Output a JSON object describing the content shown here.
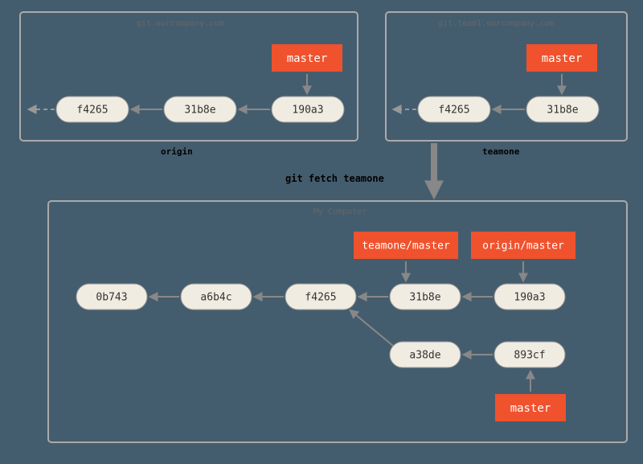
{
  "origin": {
    "host": "git.ourcompany.com",
    "label": "origin",
    "branch": "master",
    "commits": {
      "c0": "f4265",
      "c1": "31b8e",
      "c2": "190a3"
    }
  },
  "teamone": {
    "host": "git.team1.ourcompany.com",
    "label": "teamone",
    "branch": "master",
    "commits": {
      "c0": "f4265",
      "c1": "31b8e"
    }
  },
  "command": "git fetch teamone",
  "local": {
    "title": "My Computer",
    "commits": {
      "c0": "0b743",
      "c1": "a6b4c",
      "c2": "f4265",
      "c3": "31b8e",
      "c4": "190a3",
      "c5": "a38de",
      "c6": "893cf"
    },
    "refs": {
      "teamone_master": "teamone/master",
      "origin_master": "origin/master",
      "head": "master"
    }
  }
}
